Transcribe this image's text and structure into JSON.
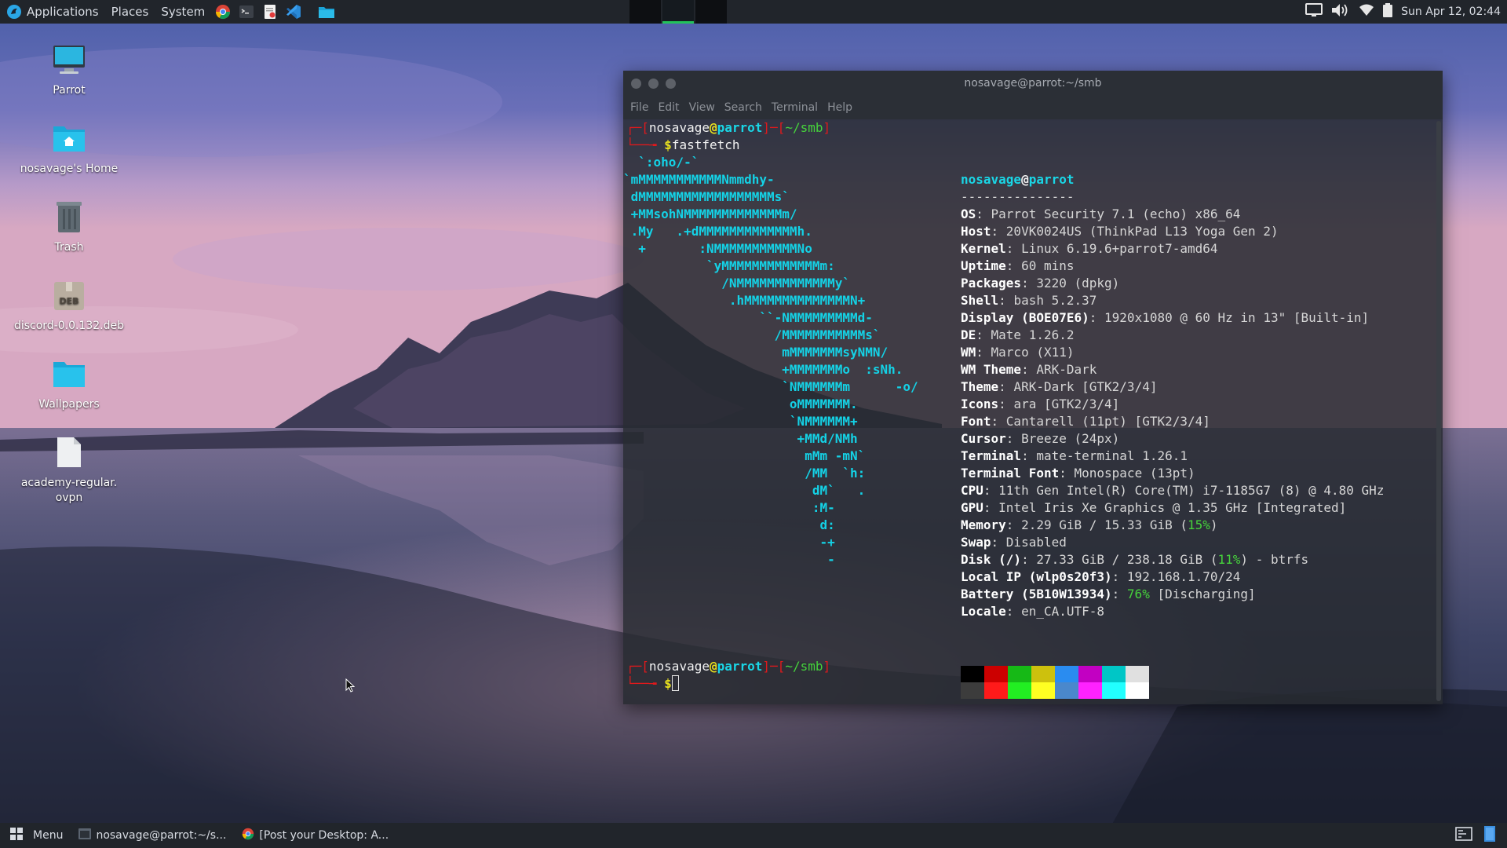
{
  "top_panel": {
    "menus": [
      "Applications",
      "Places",
      "System"
    ],
    "launchers": [
      "chrome-icon",
      "terminal-icon",
      "text-editor-icon",
      "vscode-icon",
      "folder-icon"
    ],
    "clock": "Sun Apr 12, 02:44"
  },
  "desktop_icons": [
    {
      "label": "Parrot",
      "icon": "computer-icon"
    },
    {
      "label": "nosavage's Home",
      "icon": "home-folder-icon"
    },
    {
      "label": "Trash",
      "icon": "trash-icon"
    },
    {
      "label": "discord-0.0.132.deb",
      "icon": "deb-package-icon"
    },
    {
      "label": "Wallpapers",
      "icon": "folder-icon"
    },
    {
      "label": "academy-regular.\novpn",
      "icon": "file-icon"
    }
  ],
  "terminal": {
    "title": "nosavage@parrot:~/smb",
    "menu": [
      "File",
      "Edit",
      "View",
      "Search",
      "Terminal",
      "Help"
    ],
    "prompt": {
      "user": "nosavage",
      "at": "@",
      "host": "parrot",
      "dir": "~/smb",
      "dollar": "$",
      "command": "fastfetch"
    },
    "logo": [
      "  `:oho/-`",
      "`mMMMMMMMMMMMNmmdhy-",
      " dMMMMMMMMMMMMMMMMMMs`",
      " +MMsohNMMMMMMMMMMMMMm/",
      " .My   .+dMMMMMMMMMMMMMh.",
      "  +       :NMMMMMMMMMMMNo",
      "           `yMMMMMMMMMMMMMm:",
      "             /NMMMMMMMMMMMMMy`",
      "              .hMMMMMMMMMMMMMMN+",
      "                  ``-NMMMMMMMMMd-",
      "                    /MMMMMMMMMMMs`",
      "                     mMMMMMMMsyNMN/",
      "                     +MMMMMMMo  :sNh.",
      "                     `NMMMMMMm      -o/",
      "                      oMMMMMMM.",
      "                      `NMMMMMM+",
      "                       +MMd/NMh",
      "                        mMm -mN`",
      "                        /MM  `h:",
      "                         dM`   .",
      "                         :M-",
      "                          d:",
      "                          -+",
      "                           -"
    ],
    "info_header": {
      "user": "nosavage",
      "at": "@",
      "host": "parrot",
      "sep": "---------------"
    },
    "info": [
      {
        "key": "OS",
        "value": "Parrot Security 7.1 (echo) x86_64"
      },
      {
        "key": "Host",
        "value": "20VK0024US (ThinkPad L13 Yoga Gen 2)"
      },
      {
        "key": "Kernel",
        "value": "Linux 6.19.6+parrot7-amd64"
      },
      {
        "key": "Uptime",
        "value": "60 mins"
      },
      {
        "key": "Packages",
        "value": "3220 (dpkg)"
      },
      {
        "key": "Shell",
        "value": "bash 5.2.37"
      },
      {
        "key": "Display (BOE07E6)",
        "value": "1920x1080 @ 60 Hz in 13\" [Built-in]"
      },
      {
        "key": "DE",
        "value": "Mate 1.26.2"
      },
      {
        "key": "WM",
        "value": "Marco (X11)"
      },
      {
        "key": "WM Theme",
        "value": "ARK-Dark"
      },
      {
        "key": "Theme",
        "value": "ARK-Dark [GTK2/3/4]"
      },
      {
        "key": "Icons",
        "value": "ara [GTK2/3/4]"
      },
      {
        "key": "Font",
        "value": "Cantarell (11pt) [GTK2/3/4]"
      },
      {
        "key": "Cursor",
        "value": "Breeze (24px)"
      },
      {
        "key": "Terminal",
        "value": "mate-terminal 1.26.1"
      },
      {
        "key": "Terminal Font",
        "value": "Monospace (13pt)"
      },
      {
        "key": "CPU",
        "value": "11th Gen Intel(R) Core(TM) i7-1185G7 (8) @ 4.80 GHz"
      },
      {
        "key": "GPU",
        "value": "Intel Iris Xe Graphics @ 1.35 GHz [Integrated]"
      },
      {
        "key": "Memory",
        "value": "2.29 GiB / 15.33 GiB (",
        "highlight": "15%",
        "after": ")"
      },
      {
        "key": "Swap",
        "value": "Disabled"
      },
      {
        "key": "Disk (/)",
        "value": "27.33 GiB / 238.18 GiB (",
        "highlight": "11%",
        "after": ") - btrfs"
      },
      {
        "key": "Local IP (wlp0s20f3)",
        "value": "192.168.1.70/24"
      },
      {
        "key": "Battery (5B10W13934)",
        "value": "",
        "highlight": "76%",
        "after": " [Discharging]"
      },
      {
        "key": "Locale",
        "value": "en_CA.UTF-8"
      }
    ],
    "palette_top": [
      "#000000",
      "#cc0000",
      "#16b916",
      "#cdc10d",
      "#2a8cf0",
      "#c200c2",
      "#00c6c6",
      "#e0e0e0"
    ],
    "palette_bottom": [
      "#3c3c3c",
      "#ff1a1a",
      "#22ee22",
      "#ffff22",
      "#4a88cc",
      "#ff22ff",
      "#22ffff",
      "#ffffff"
    ]
  },
  "bottom_panel": {
    "menu_label": "Menu",
    "tasks": [
      {
        "label": "nosavage@parrot:~/s...",
        "icon": "terminal-icon"
      },
      {
        "label": "[Post your Desktop: A...",
        "icon": "chrome-icon"
      }
    ]
  }
}
